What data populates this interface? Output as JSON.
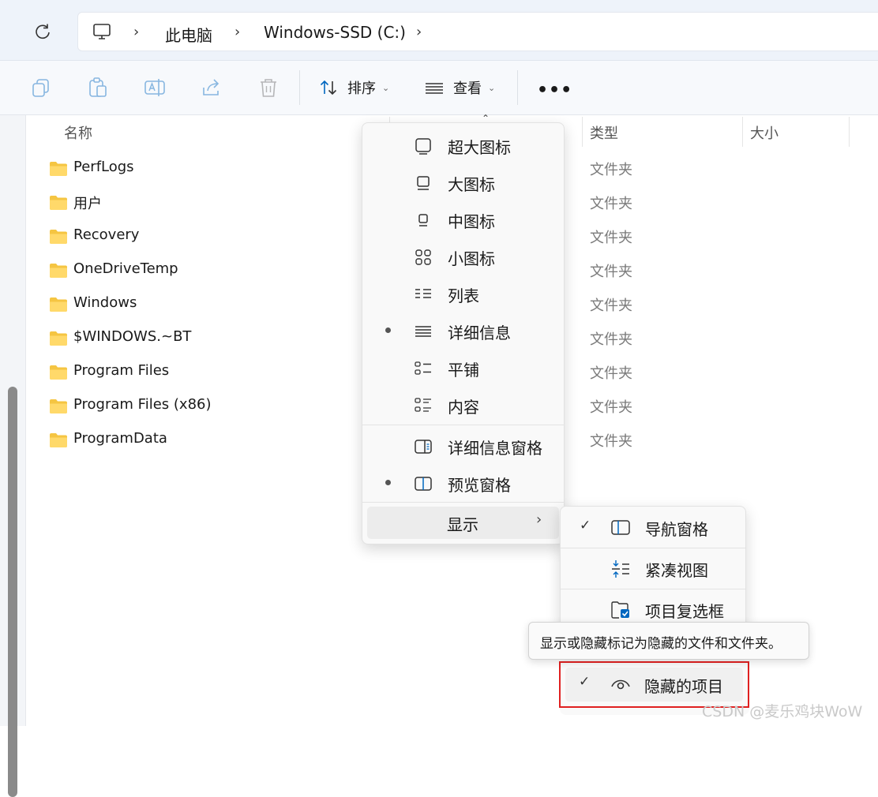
{
  "address": {
    "crumbs": [
      "此电脑",
      "Windows-SSD (C:)"
    ]
  },
  "toolbar": {
    "sort_label": "排序",
    "view_label": "查看",
    "more_label": "•••"
  },
  "columns": {
    "name": "名称",
    "type": "类型",
    "size": "大小"
  },
  "files": [
    {
      "name": "PerfLogs",
      "type": "文件夹"
    },
    {
      "name": "用户",
      "type": "文件夹"
    },
    {
      "name": "Recovery",
      "type": "文件夹"
    },
    {
      "name": "OneDriveTemp",
      "type": "文件夹"
    },
    {
      "name": "Windows",
      "type": "文件夹"
    },
    {
      "name": "$WINDOWS.~BT",
      "type": "文件夹"
    },
    {
      "name": "Program Files",
      "type": "文件夹"
    },
    {
      "name": "Program Files (x86)",
      "type": "文件夹"
    },
    {
      "name": "ProgramData",
      "type": "文件夹"
    }
  ],
  "view_menu": {
    "items": [
      {
        "label": "超大图标",
        "icon": "extra-large-icons-icon",
        "selected": false
      },
      {
        "label": "大图标",
        "icon": "large-icons-icon",
        "selected": false
      },
      {
        "label": "中图标",
        "icon": "medium-icons-icon",
        "selected": false
      },
      {
        "label": "小图标",
        "icon": "small-icons-icon",
        "selected": false
      },
      {
        "label": "列表",
        "icon": "list-icon",
        "selected": false
      },
      {
        "label": "详细信息",
        "icon": "details-icon",
        "selected": true
      },
      {
        "label": "平铺",
        "icon": "tiles-icon",
        "selected": false
      },
      {
        "label": "内容",
        "icon": "content-icon",
        "selected": false
      }
    ],
    "panes": [
      {
        "label": "详细信息窗格",
        "icon": "details-pane-icon",
        "selected": false
      },
      {
        "label": "预览窗格",
        "icon": "preview-pane-icon",
        "selected": true
      }
    ],
    "show_label": "显示"
  },
  "show_submenu": {
    "items": [
      {
        "label": "导航窗格",
        "checked": true,
        "icon": "navigation-pane-icon"
      },
      {
        "label": "紧凑视图",
        "checked": false,
        "icon": "compact-view-icon"
      },
      {
        "label": "项目复选框",
        "checked": false,
        "icon": "item-checkboxes-icon"
      }
    ],
    "hidden_items_label": "隐藏的项目",
    "hidden_items_checked": true
  },
  "tooltip": "显示或隐藏标记为隐藏的文件和文件夹。",
  "watermark": "CSDN @麦乐鸡块WoW",
  "colors": {
    "accent": "#0067c0",
    "highlight": "#e02020",
    "folder": "#f5c542"
  }
}
